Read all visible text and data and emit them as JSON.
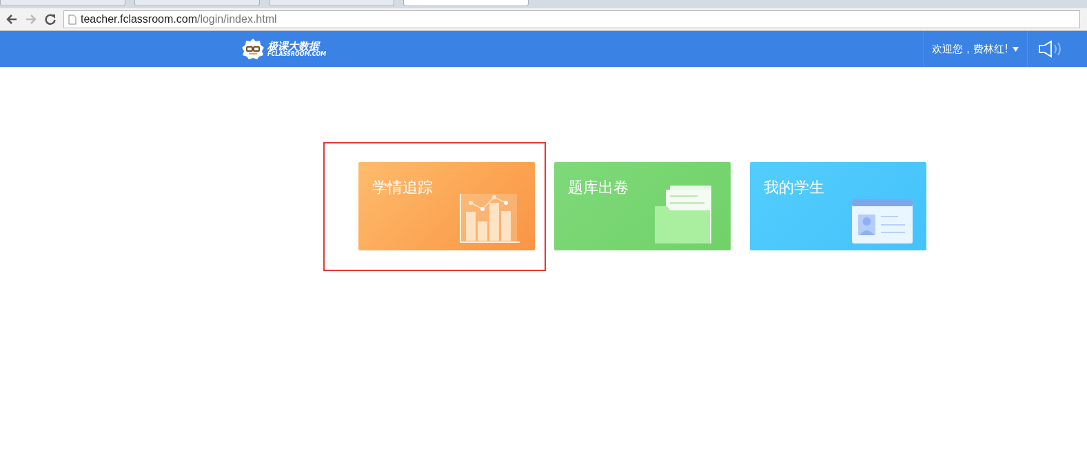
{
  "browser": {
    "tabs": [
      {
        "selected": false
      },
      {
        "selected": false
      },
      {
        "selected": false
      },
      {
        "selected": true
      }
    ],
    "url_host": "teacher.fclassroom.com",
    "url_path": "/login/index.html"
  },
  "header": {
    "logo_title": "极课大数据",
    "logo_subtitle": "FCLASSROOM.COM",
    "welcome": "欢迎您，费林红!"
  },
  "cards": [
    {
      "title": "学情追踪",
      "kind": "chart",
      "selected": true
    },
    {
      "title": "题库出卷",
      "kind": "folder",
      "selected": false
    },
    {
      "title": "我的学生",
      "kind": "idcard",
      "selected": false
    }
  ]
}
